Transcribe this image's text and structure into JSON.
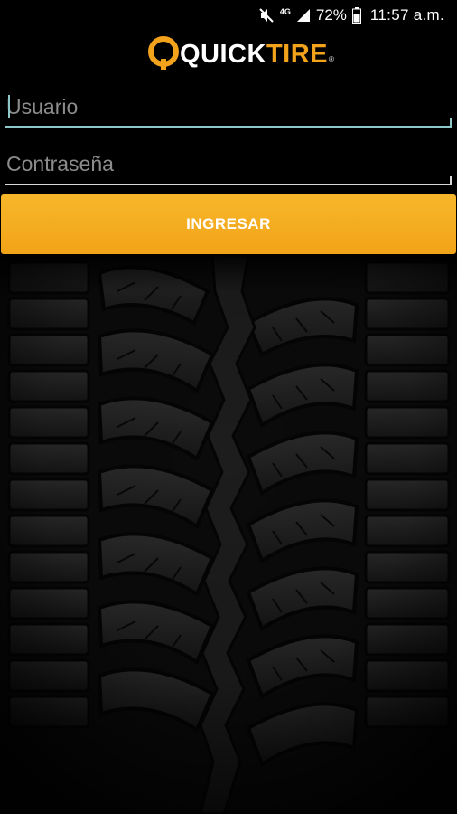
{
  "status_bar": {
    "network_type": "4G",
    "battery": "72%",
    "time": "11:57 a.m.",
    "icons": [
      "mute-icon",
      "signal-icon",
      "battery-icon"
    ]
  },
  "logo": {
    "quick": "QUICK",
    "tire": "TIRE",
    "registered": "®",
    "brand_color": "#f2a21b"
  },
  "form": {
    "username_placeholder": "Usuario",
    "password_placeholder": "Contraseña",
    "submit_label": "INGRESAR",
    "accent_color": "#8fc8c8",
    "button_color": "#f5ad20"
  }
}
